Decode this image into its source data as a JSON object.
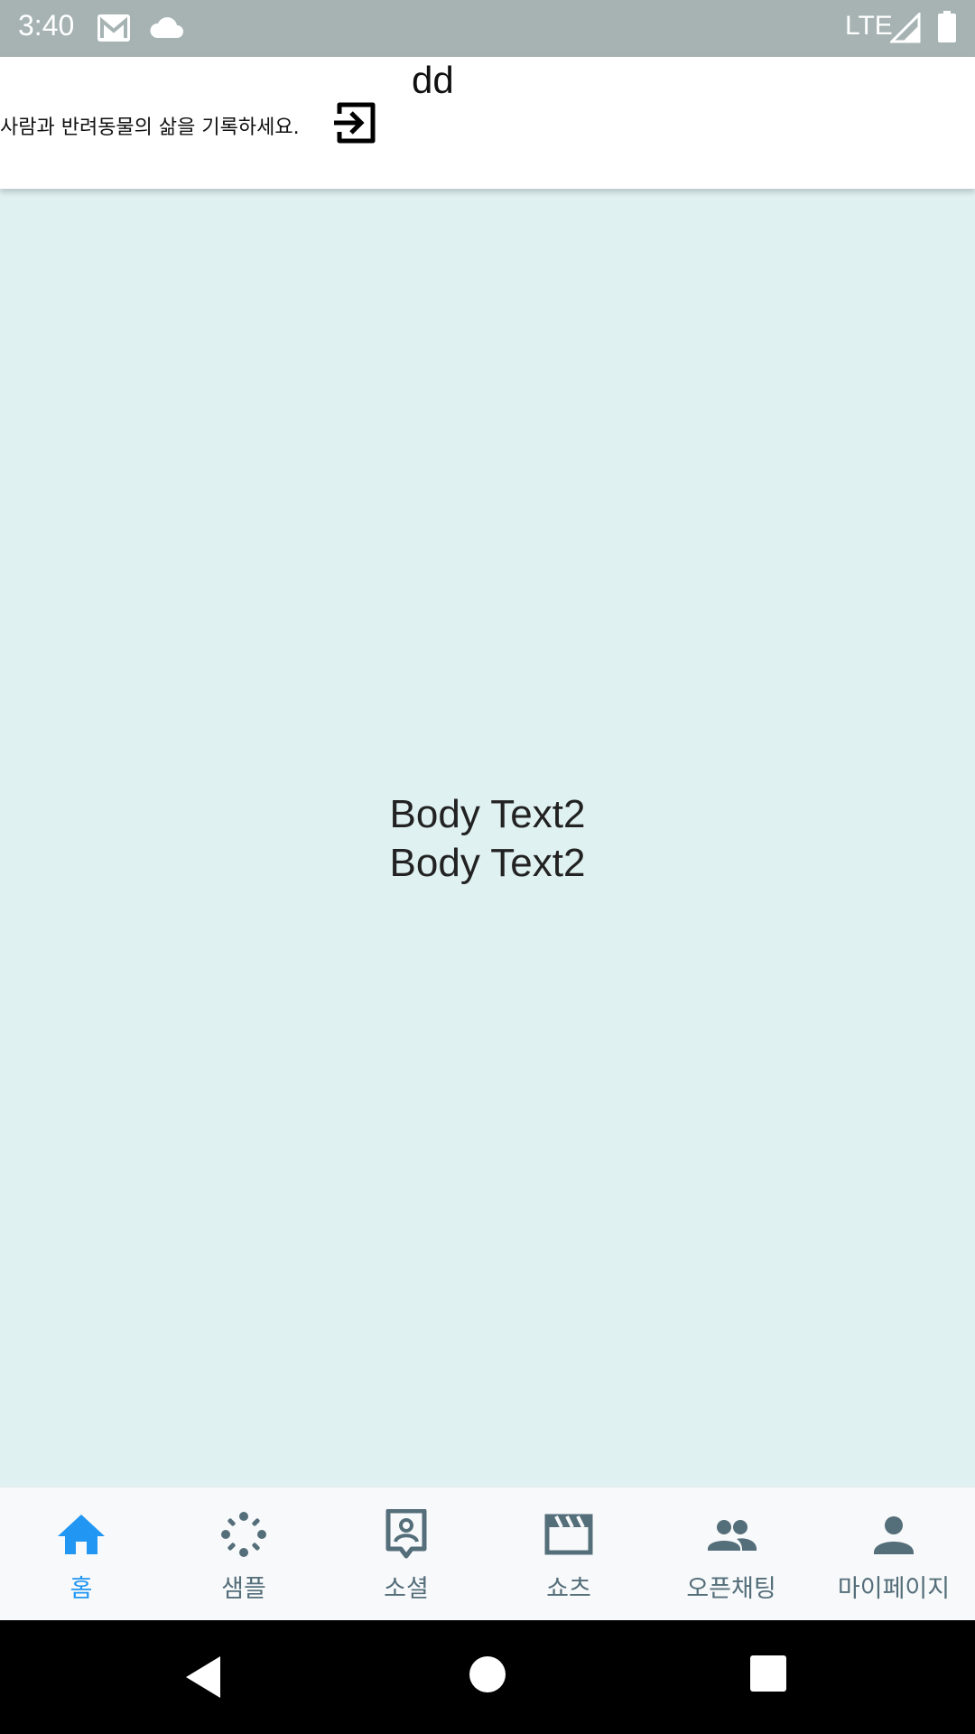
{
  "status_bar": {
    "time": "3:40",
    "network": "LTE",
    "icons": [
      "gmail-icon",
      "cloud-icon",
      "signal-icon",
      "battery-icon"
    ]
  },
  "header": {
    "title": "dd",
    "tagline": "사람과 반려동물의 삶을 기록하세요.",
    "login_icon": "login-icon"
  },
  "main": {
    "body_lines": [
      "Body Text2",
      "Body Text2"
    ],
    "background": "#e0f1f1"
  },
  "bottom_nav": {
    "active_color": "#2196f3",
    "inactive_color": "#546e7a",
    "items": [
      {
        "label": "홈",
        "icon": "home-icon",
        "active": true
      },
      {
        "label": "샘플",
        "icon": "sample-icon",
        "active": false
      },
      {
        "label": "소셜",
        "icon": "contact-icon",
        "active": false
      },
      {
        "label": "쇼츠",
        "icon": "clapperboard-icon",
        "active": false
      },
      {
        "label": "오픈채팅",
        "icon": "group-icon",
        "active": false
      },
      {
        "label": "마이페이지",
        "icon": "person-icon",
        "active": false
      }
    ]
  },
  "system_nav": {
    "icons": [
      "back-icon",
      "home-circle-icon",
      "recents-icon"
    ]
  }
}
